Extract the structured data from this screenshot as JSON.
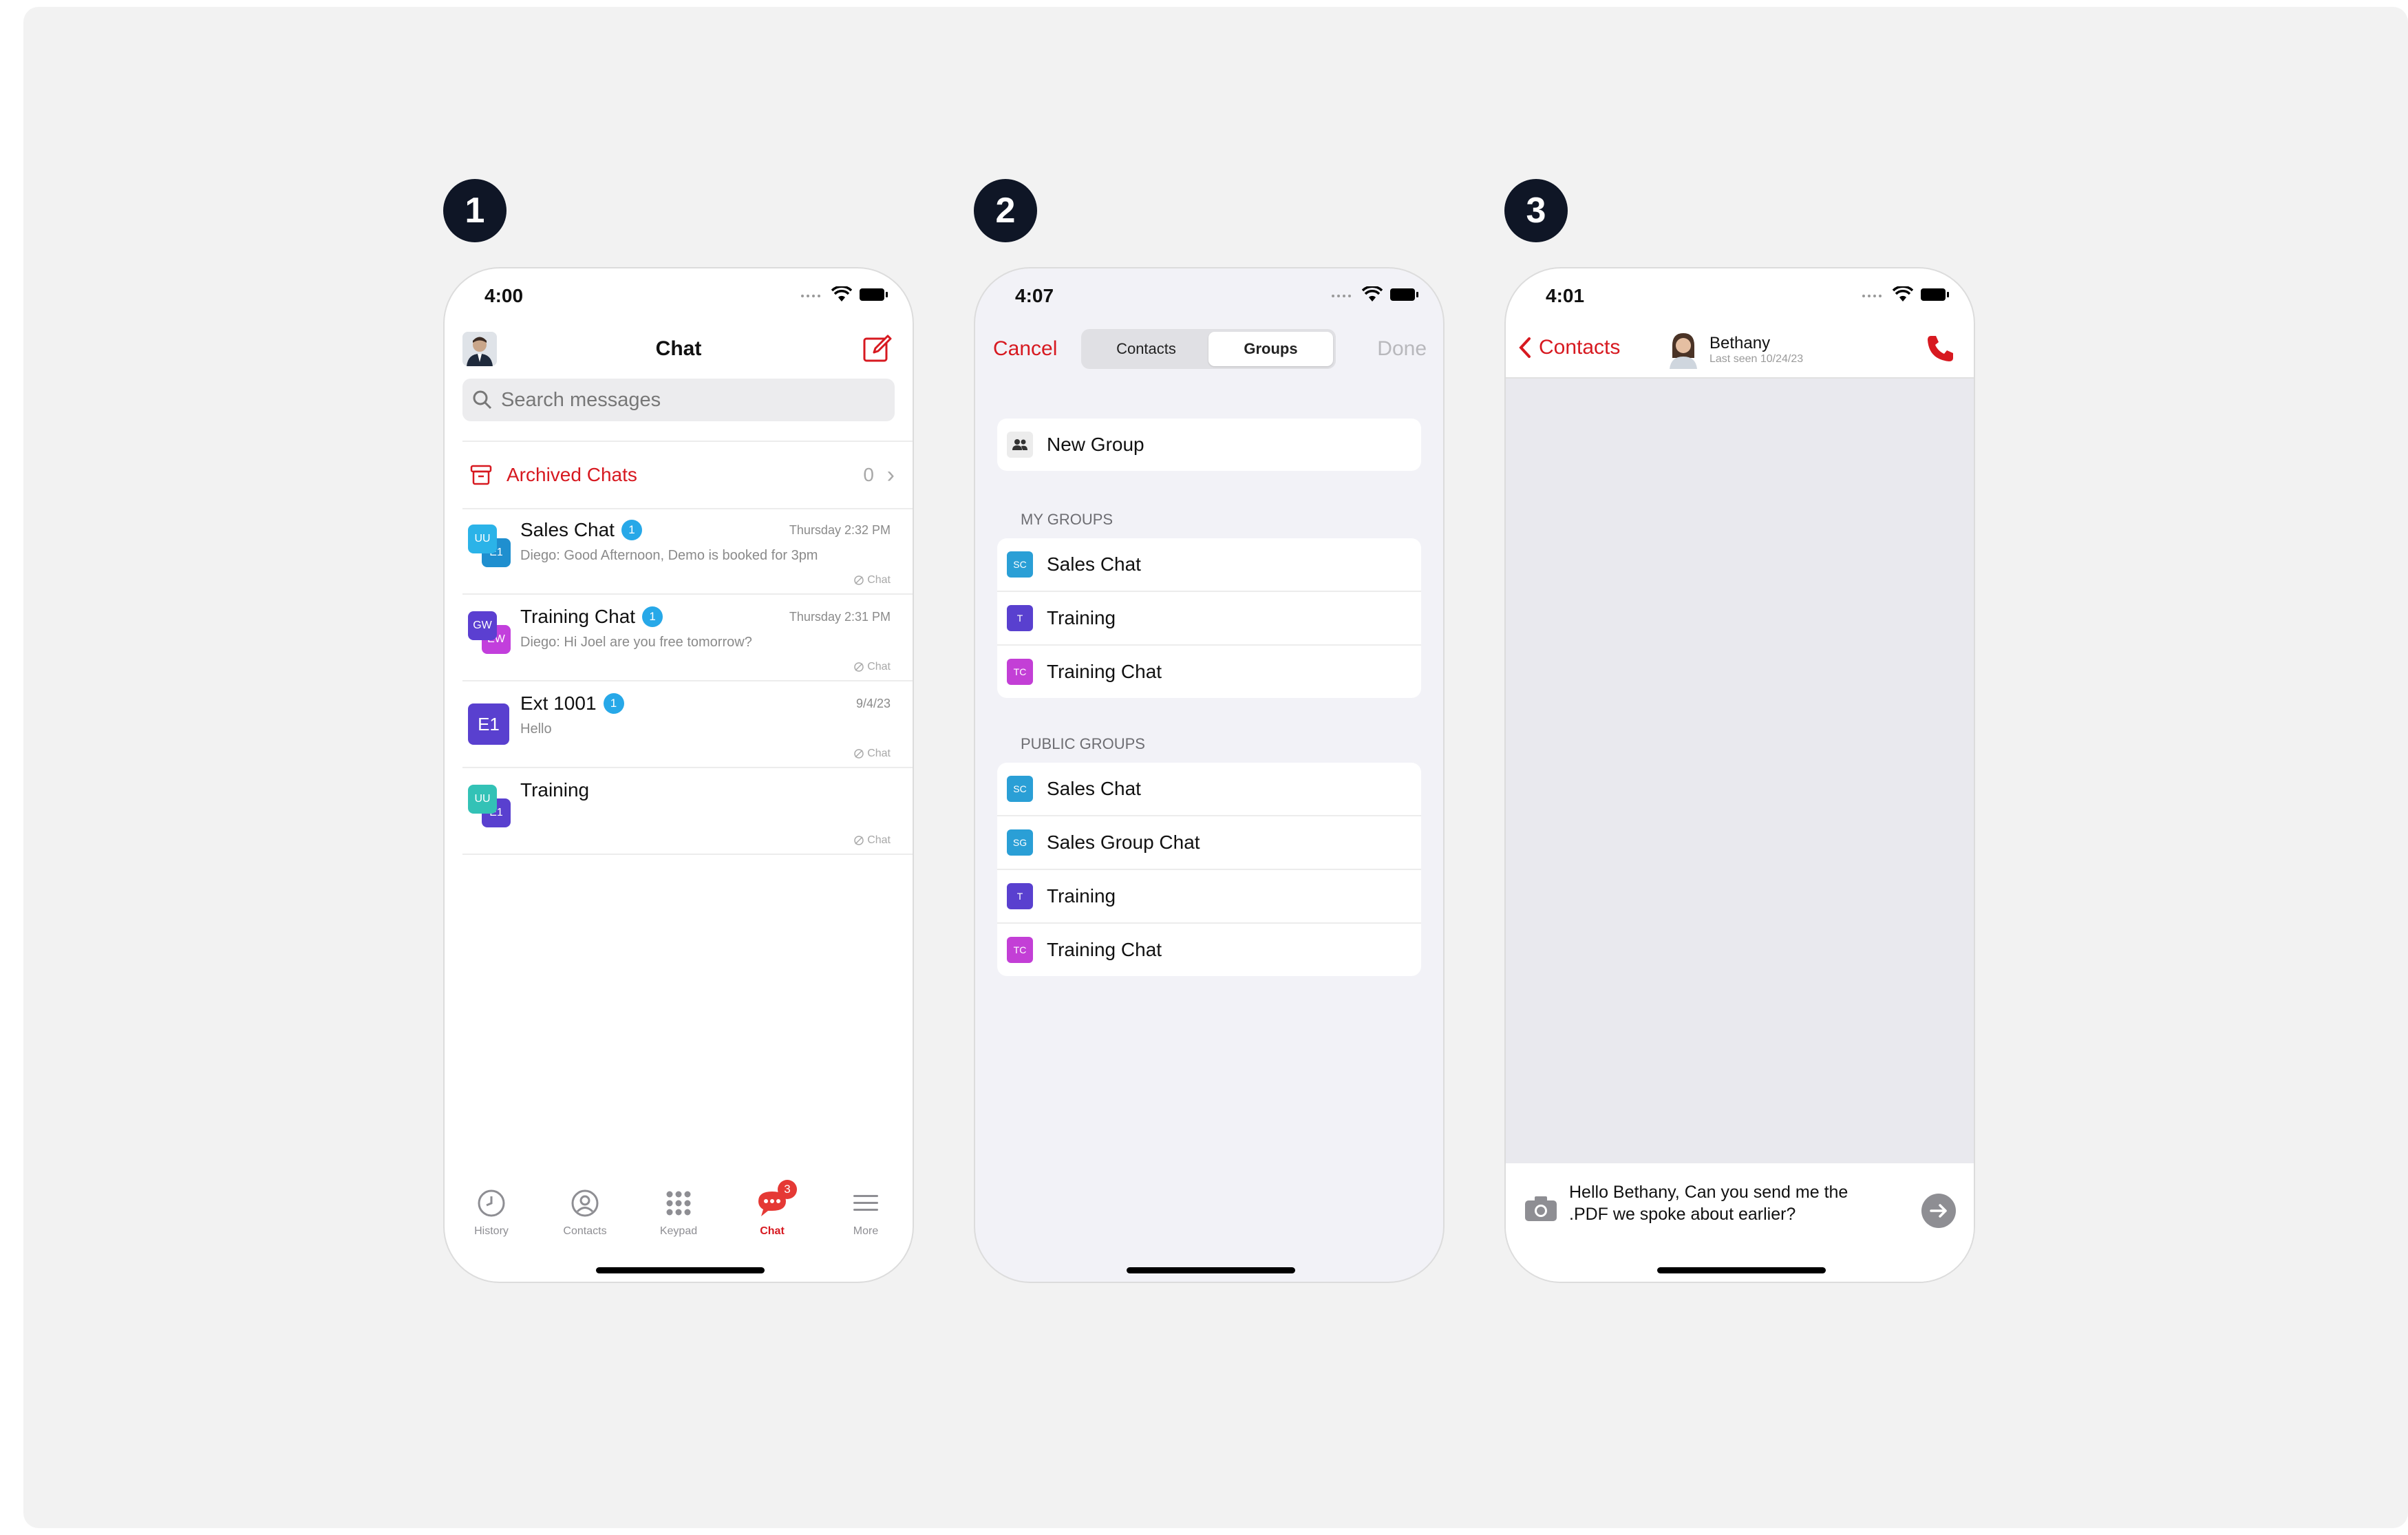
{
  "steps": [
    "1",
    "2",
    "3"
  ],
  "phone1": {
    "status_time": "4:00",
    "title": "Chat",
    "search_placeholder": "Search messages",
    "archived": {
      "label": "Archived Chats",
      "count": "0"
    },
    "chats": [
      {
        "name": "Sales Chat",
        "badge": "1",
        "time": "Thursday 2:32 PM",
        "preview": "Diego: Good Afternoon, Demo is booked for 3pm",
        "tag": "Chat",
        "avatar": {
          "a": "UU",
          "b": "E1",
          "colors": [
            "#2bb3e8",
            "#1f8fcf"
          ]
        }
      },
      {
        "name": "Training Chat",
        "badge": "1",
        "time": "Thursday 2:31 PM",
        "preview": "Diego: Hi Joel are you free tomorrow?",
        "tag": "Chat",
        "avatar": {
          "a": "GW",
          "b": "EW",
          "colors": [
            "#5b3fd1",
            "#c23fdc"
          ]
        }
      },
      {
        "name": "Ext 1001",
        "badge": "1",
        "time": "9/4/23",
        "preview": "Hello",
        "tag": "Chat",
        "avatar": {
          "single": "E1",
          "colors": [
            "#5940cf"
          ]
        }
      },
      {
        "name": "Training",
        "badge": "",
        "time": "",
        "preview": "",
        "tag": "Chat",
        "avatar": {
          "a": "UU",
          "b": "E1",
          "colors": [
            "#33c2b6",
            "#5940cf"
          ]
        }
      }
    ],
    "tabs": [
      {
        "label": "History",
        "icon": "clock-icon"
      },
      {
        "label": "Contacts",
        "icon": "person-circle-icon"
      },
      {
        "label": "Keypad",
        "icon": "keypad-icon"
      },
      {
        "label": "Chat",
        "icon": "chat-bubble-icon",
        "badge": "3"
      },
      {
        "label": "More",
        "icon": "menu-icon"
      }
    ]
  },
  "phone2": {
    "status_time": "4:07",
    "cancel": "Cancel",
    "done": "Done",
    "segments": [
      "Contacts",
      "Groups"
    ],
    "selected_segment": "Groups",
    "new_group": "New Group",
    "my_groups_header": "MY GROUPS",
    "my_groups": [
      {
        "abbr": "SC",
        "name": "Sales Chat",
        "color": "#2a9fd6"
      },
      {
        "abbr": "T",
        "name": "Training",
        "color": "#5940cf"
      },
      {
        "abbr": "TC",
        "name": "Training Chat",
        "color": "#c33fd6"
      }
    ],
    "public_groups_header": "PUBLIC GROUPS",
    "public_groups": [
      {
        "abbr": "SC",
        "name": "Sales Chat",
        "color": "#2a9fd6"
      },
      {
        "abbr": "SG",
        "name": "Sales Group Chat",
        "color": "#2a9fd6"
      },
      {
        "abbr": "T",
        "name": "Training",
        "color": "#5940cf"
      },
      {
        "abbr": "TC",
        "name": "Training Chat",
        "color": "#c33fd6"
      }
    ]
  },
  "phone3": {
    "status_time": "4:01",
    "back_label": "Contacts",
    "peer_name": "Bethany",
    "peer_status": "Last seen 10/24/23",
    "draft_message": "Hello Bethany, Can you send me the .PDF we spoke about earlier?"
  },
  "colors": {
    "accent_red": "#d71920",
    "badge_blue": "#27a8e8"
  }
}
